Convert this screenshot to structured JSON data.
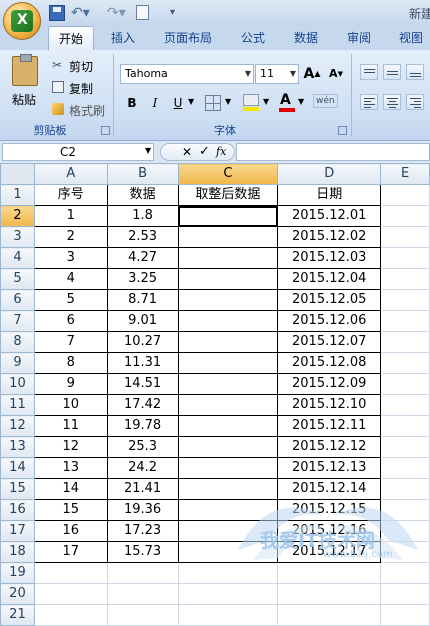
{
  "app": {
    "title": "新建"
  },
  "tabs": [
    {
      "label": "开始",
      "active": true
    },
    {
      "label": "插入"
    },
    {
      "label": "页面布局"
    },
    {
      "label": "公式"
    },
    {
      "label": "数据"
    },
    {
      "label": "审阅"
    },
    {
      "label": "视图"
    }
  ],
  "clipboard": {
    "paste": "粘贴",
    "cut": "剪切",
    "copy": "复制",
    "format_painter": "格式刷",
    "group": "剪贴板"
  },
  "font": {
    "name": "Tahoma",
    "size": "11",
    "group": "字体",
    "bold": "B",
    "italic": "I",
    "underline": "U",
    "grow": "A",
    "shrink": "A",
    "font_color": "A",
    "phonetic": "wén"
  },
  "formula_bar": {
    "name_box": "C2",
    "fx": "fx",
    "cancel": "✕",
    "enter": "✓",
    "formula": ""
  },
  "columns": [
    "A",
    "B",
    "C",
    "D",
    "E"
  ],
  "headers": [
    "序号",
    "数据",
    "取整后数据",
    "日期"
  ],
  "rows": [
    [
      "1",
      "1.8",
      "",
      "2015.12.01"
    ],
    [
      "2",
      "2.53",
      "",
      "2015.12.02"
    ],
    [
      "3",
      "4.27",
      "",
      "2015.12.03"
    ],
    [
      "4",
      "3.25",
      "",
      "2015.12.04"
    ],
    [
      "5",
      "8.71",
      "",
      "2015.12.05"
    ],
    [
      "6",
      "9.01",
      "",
      "2015.12.06"
    ],
    [
      "7",
      "10.27",
      "",
      "2015.12.07"
    ],
    [
      "8",
      "11.31",
      "",
      "2015.12.08"
    ],
    [
      "9",
      "14.51",
      "",
      "2015.12.09"
    ],
    [
      "10",
      "17.42",
      "",
      "2015.12.10"
    ],
    [
      "11",
      "19.78",
      "",
      "2015.12.11"
    ],
    [
      "12",
      "25.3",
      "",
      "2015.12.12"
    ],
    [
      "13",
      "24.2",
      "",
      "2015.12.13"
    ],
    [
      "14",
      "21.41",
      "",
      "2015.12.14"
    ],
    [
      "15",
      "19.36",
      "",
      "2015.12.15"
    ],
    [
      "16",
      "17.23",
      "",
      "2015.12.16"
    ],
    [
      "17",
      "15.73",
      "",
      "2015.12.17"
    ]
  ],
  "row_numbers": [
    "1",
    "2",
    "3",
    "4",
    "5",
    "6",
    "7",
    "8",
    "9",
    "10",
    "11",
    "12",
    "13",
    "14",
    "15",
    "16",
    "17",
    "18",
    "19",
    "20",
    "21"
  ],
  "selected": {
    "column": "C",
    "row": "2"
  },
  "watermark": {
    "text": "我爱IT技术网",
    "url": "www.52ij.com"
  },
  "colors": {
    "ribbon": "#cfe0f4",
    "header_sel": "#f1b74a",
    "grid": "#d0d7e5",
    "tab_text": "#15428b"
  }
}
